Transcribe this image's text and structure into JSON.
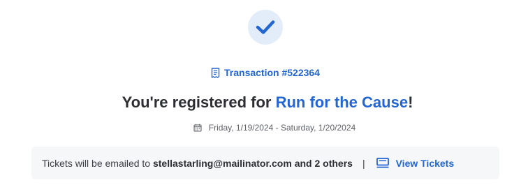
{
  "transaction": {
    "label": "Transaction #522364",
    "icon": "receipt-icon"
  },
  "heading": {
    "prefix": "You're registered for ",
    "event_name": "Run for the Cause",
    "suffix": "!"
  },
  "event_dates": {
    "icon": "calendar-icon",
    "text": "Friday, 1/19/2024 - Saturday, 1/20/2024"
  },
  "tickets_banner": {
    "prefix": "Tickets will be emailed to ",
    "email": "stellastarling@mailinator.com",
    "others": " and 2 others",
    "separator": "|",
    "view_label": "View Tickets",
    "view_icon": "ticket-icon"
  },
  "colors": {
    "accent": "#2366d1",
    "check_bg": "#e3edf9",
    "banner_bg": "#f6f7f9",
    "heading_text": "#2d2e33"
  },
  "status_icon": "check-icon"
}
